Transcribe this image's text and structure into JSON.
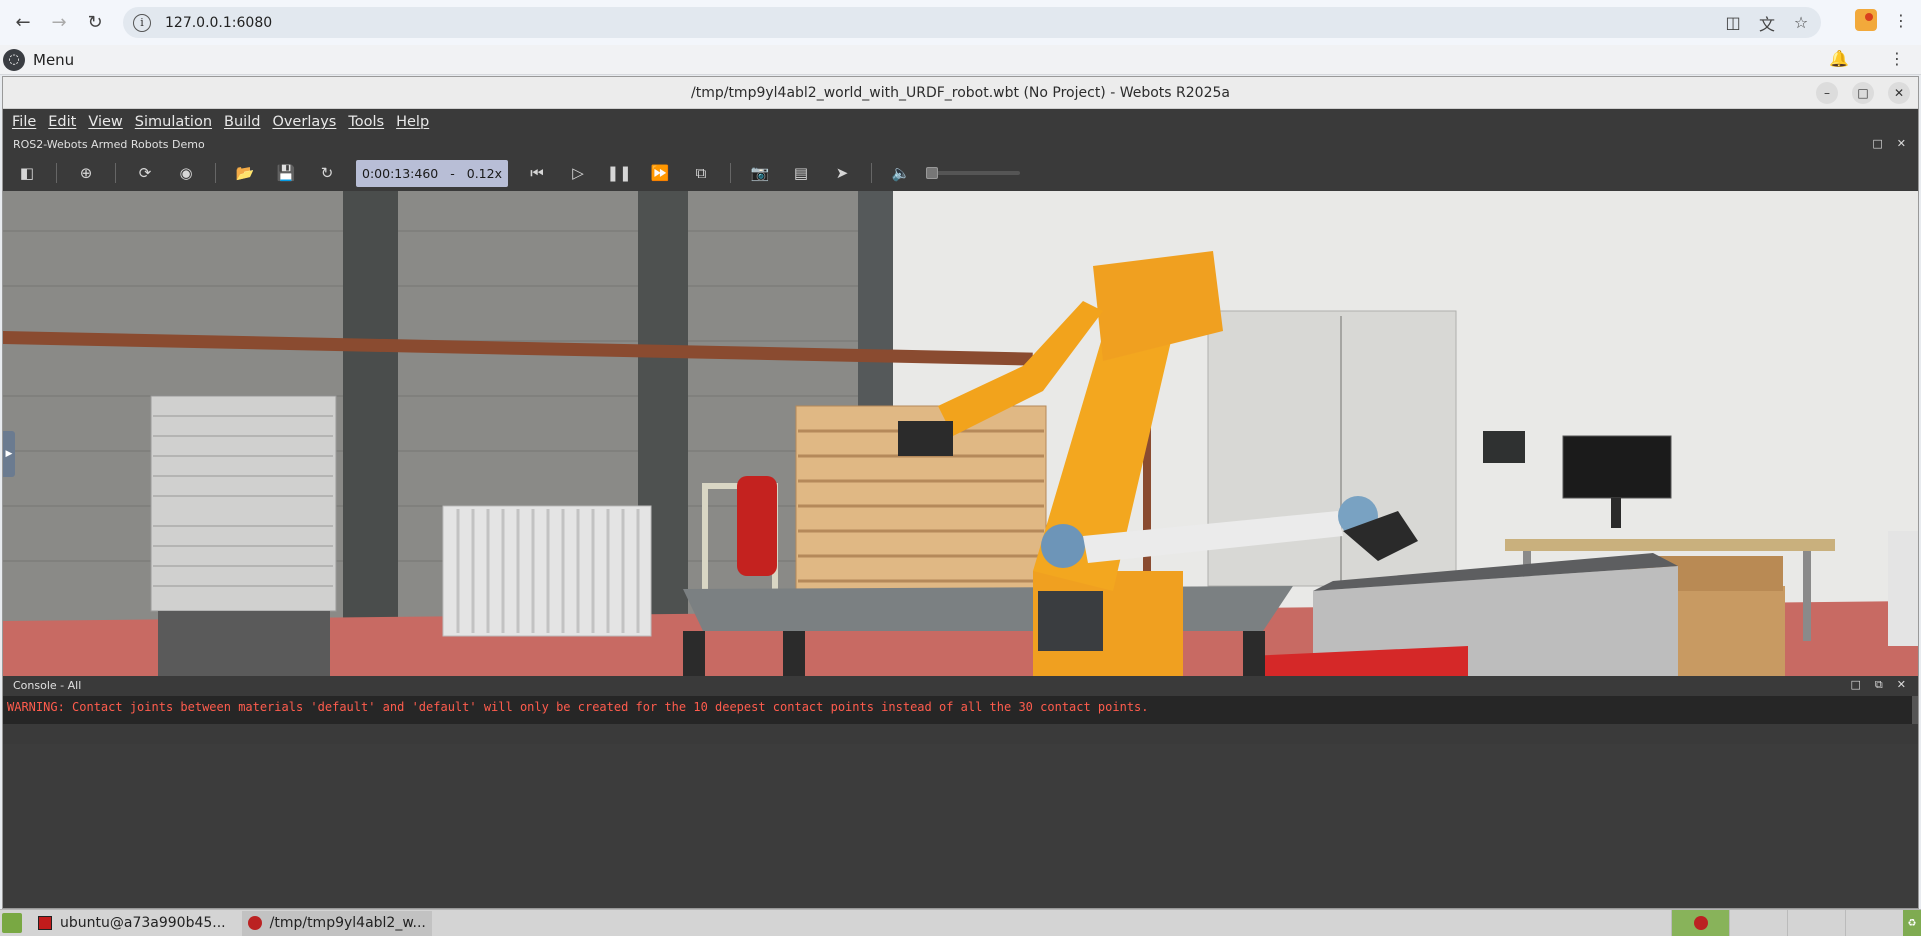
{
  "browser": {
    "url": "127.0.0.1:6080",
    "back_icon": "arrow-left-icon",
    "forward_icon": "arrow-right-icon",
    "reload_icon": "reload-icon"
  },
  "desktop": {
    "menu_label": "Menu"
  },
  "window": {
    "title": "/tmp/tmp9yl4abl2_world_with_URDF_robot.wbt (No Project) - Webots R2025a"
  },
  "menubar": {
    "items": [
      "File",
      "Edit",
      "View",
      "Simulation",
      "Build",
      "Overlays",
      "Tools",
      "Help"
    ]
  },
  "scene": {
    "title": "ROS2-Webots Armed Robots Demo"
  },
  "toolbar": {
    "time": "0:00:13:460",
    "separator": "-",
    "speed": "0.12x"
  },
  "console": {
    "title": "Console - All",
    "message": "WARNING: Contact joints between materials 'default' and 'default' will only be created for the 10 deepest contact points instead of all the 30 contact points."
  },
  "taskbar": {
    "items": [
      "ubuntu@a73a990b45...",
      "/tmp/tmp9yl4abl2_w..."
    ]
  },
  "colors": {
    "robot_orange": "#f0a020",
    "floor": "#c86a63",
    "console_warning": "#ff5c4d",
    "time_box": "#b8bed6"
  }
}
